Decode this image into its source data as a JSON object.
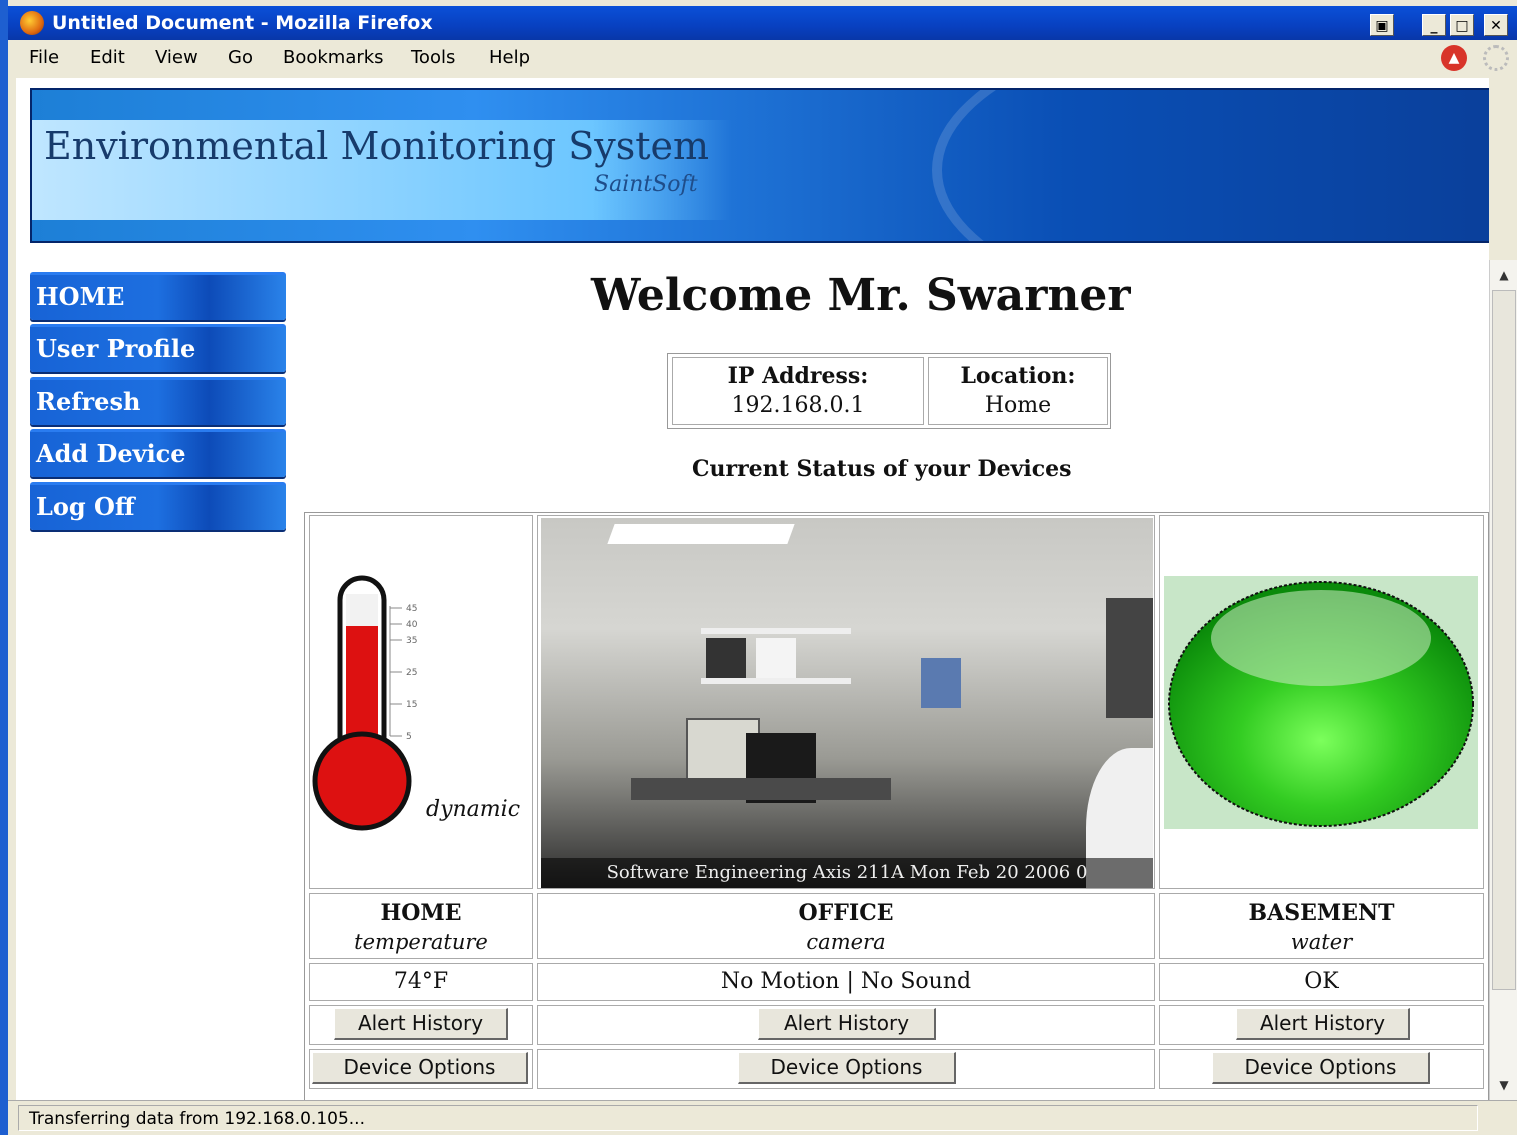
{
  "window": {
    "title": "Untitled Document - Mozilla Firefox"
  },
  "menu": {
    "items": [
      "File",
      "Edit",
      "View",
      "Go",
      "Bookmarks",
      "Tools",
      "Help"
    ]
  },
  "banner": {
    "title": "Environmental Monitoring System",
    "brand": "SaintSoft"
  },
  "nav": {
    "items": [
      "HOME",
      "User Profile",
      "Refresh",
      "Add Device",
      "Log Off"
    ]
  },
  "welcome": "Welcome Mr. Swarner",
  "info": {
    "ip_label": "IP Address:",
    "ip_value": "192.168.0.1",
    "loc_label": "Location:",
    "loc_value": "Home"
  },
  "status_heading": "Current Status of your Devices",
  "devices": [
    {
      "location": "HOME",
      "type": "temperature",
      "reading": "74°F",
      "image_caption": "dynamic",
      "alert_label": "Alert History",
      "options_label": "Device Options"
    },
    {
      "location": "OFFICE",
      "type": "camera",
      "reading": "No Motion | No Sound",
      "image_caption": "Software Engineering Axis 211A     Mon Feb 20 2006 0",
      "alert_label": "Alert History",
      "options_label": "Device Options"
    },
    {
      "location": "BASEMENT",
      "type": "water",
      "reading": "OK",
      "image_caption": "",
      "alert_label": "Alert History",
      "options_label": "Device Options"
    }
  ],
  "thermometer": {
    "ticks": [
      "45",
      "40",
      "35",
      "25",
      "15",
      "5"
    ]
  },
  "statusbar": {
    "text": "Transferring data from 192.168.0.105..."
  },
  "colors": {
    "accent": "#1d6fe0",
    "titlebar": "#0840c0",
    "water_ok": "#22aa22"
  }
}
